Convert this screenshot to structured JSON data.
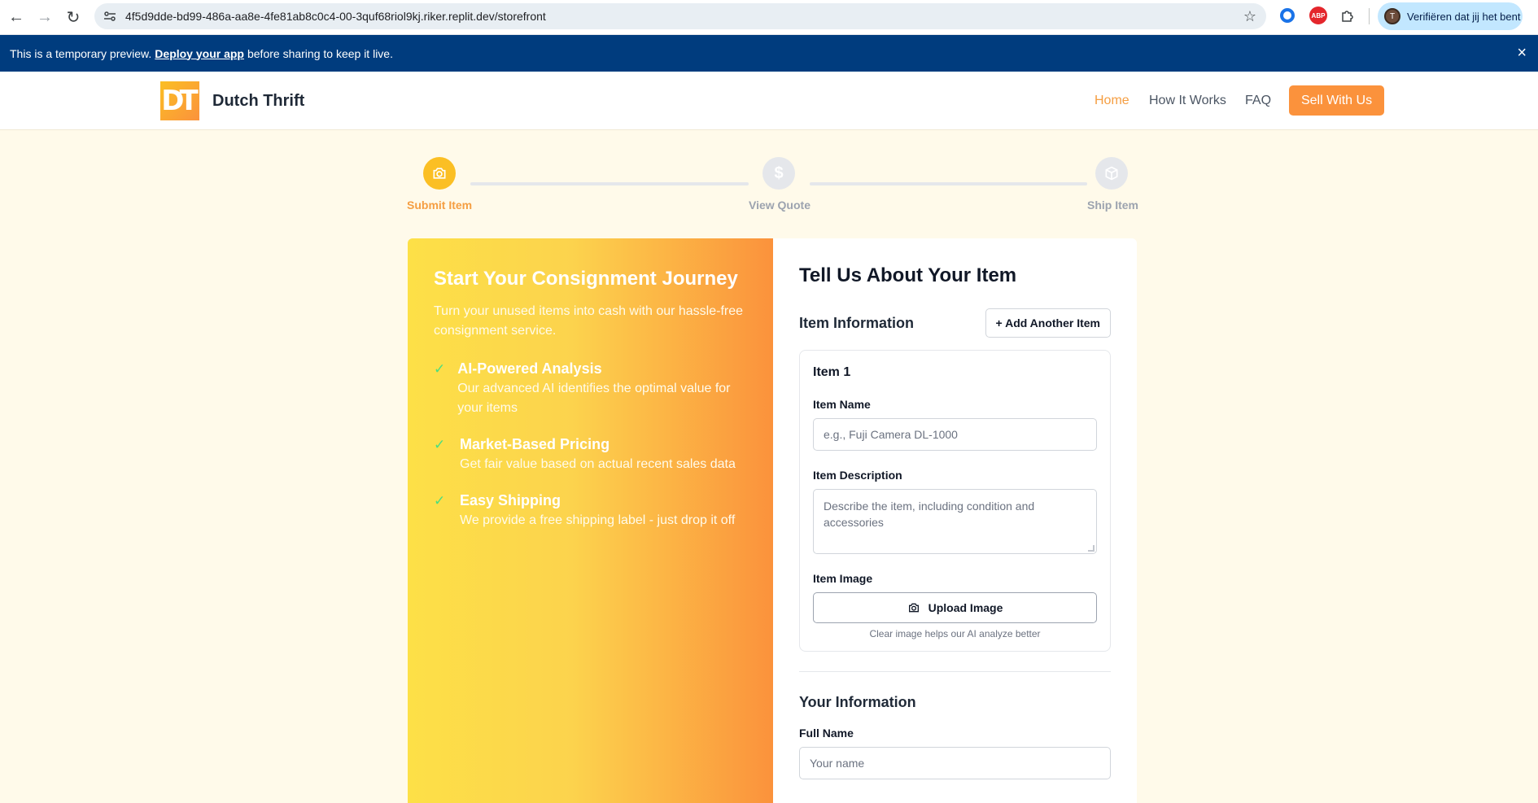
{
  "browser": {
    "url": "4f5d9dde-bd99-486a-aa8e-4fe81ab8c0c4-00-3quf68riol9kj.riker.replit.dev/storefront",
    "profile_initial": "T",
    "profile_label": "Verifiëren dat jij het bent"
  },
  "banner": {
    "text_before": "This is a temporary preview.",
    "link": "Deploy your app",
    "text_after": "before sharing to keep it live.",
    "close": "×"
  },
  "header": {
    "logo_text": "DT",
    "brand": "Dutch Thrift",
    "nav": [
      "Home",
      "How It Works",
      "FAQ"
    ],
    "cta": "Sell With Us",
    "accent": "#f59e42"
  },
  "stepper": {
    "steps": [
      {
        "label": "Submit Item",
        "icon": "camera-icon",
        "active": true
      },
      {
        "label": "View Quote",
        "icon": "dollar-icon",
        "active": false
      },
      {
        "label": "Ship Item",
        "icon": "package-icon",
        "active": false
      }
    ]
  },
  "left": {
    "title": "Start Your Consignment Journey",
    "subtitle": "Turn your unused items into cash with our hassle-free consignment service.",
    "features": [
      {
        "title": "AI-Powered Analysis",
        "desc": "Our advanced AI identifies the optimal value for your items"
      },
      {
        "title": "Market-Based Pricing",
        "desc": "Get fair value based on actual recent sales data"
      },
      {
        "title": "Easy Shipping",
        "desc": "We provide a free shipping label - just drop it off"
      }
    ]
  },
  "form": {
    "title": "Tell Us About Your Item",
    "item_section": "Item Information",
    "add_item": "+ Add Another Item",
    "item_title": "Item 1",
    "item_name_label": "Item Name",
    "item_name_placeholder": "e.g., Fuji Camera DL-1000",
    "item_desc_label": "Item Description",
    "item_desc_placeholder": "Describe the item, including condition and accessories",
    "item_image_label": "Item Image",
    "upload_label": "Upload Image",
    "upload_hint": "Clear image helps our AI analyze better",
    "your_info": "Your Information",
    "full_name_label": "Full Name",
    "full_name_placeholder": "Your name"
  }
}
